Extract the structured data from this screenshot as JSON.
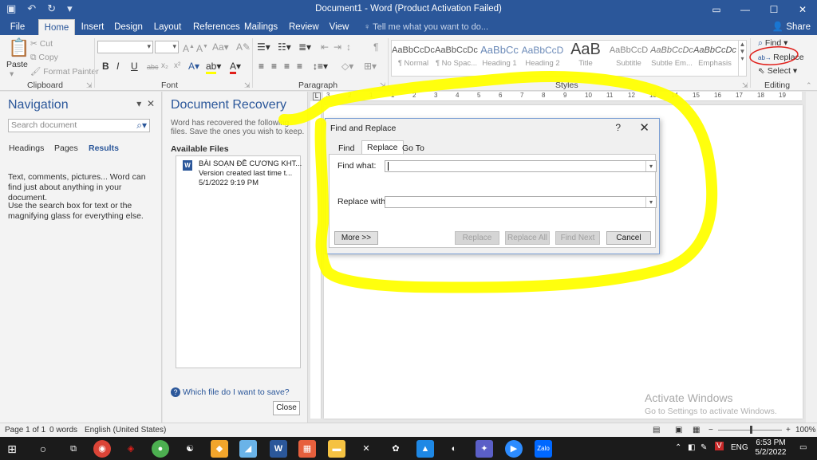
{
  "window": {
    "title": "Document1 - Word (Product Activation Failed)",
    "share": "Share",
    "tell_me": "Tell me what you want to do..."
  },
  "tabs": [
    "File",
    "Home",
    "Insert",
    "Design",
    "Layout",
    "References",
    "Mailings",
    "Review",
    "View"
  ],
  "ribbon": {
    "clipboard": {
      "paste": "Paste",
      "cut": "Cut",
      "copy": "Copy",
      "format_painter": "Format Painter",
      "label": "Clipboard"
    },
    "font": {
      "label": "Font",
      "bold": "B",
      "italic": "I",
      "underline": "U"
    },
    "paragraph": {
      "label": "Paragraph"
    },
    "styles": {
      "label": "Styles",
      "items": [
        {
          "preview": "AaBbCcDc",
          "name": "¶ Normal"
        },
        {
          "preview": "AaBbCcDc",
          "name": "¶ No Spac..."
        },
        {
          "preview": "AaBbCc",
          "name": "Heading 1"
        },
        {
          "preview": "AaBbCcD",
          "name": "Heading 2"
        },
        {
          "preview": "AaB",
          "name": "Title"
        },
        {
          "preview": "AaBbCcD",
          "name": "Subtitle"
        },
        {
          "preview": "AaBbCcDc",
          "name": "Subtle Em..."
        },
        {
          "preview": "AaBbCcDc",
          "name": "Emphasis"
        }
      ]
    },
    "editing": {
      "find": "Find",
      "replace": "Replace",
      "select": "Select",
      "label": "Editing"
    }
  },
  "navigation": {
    "title": "Navigation",
    "search_placeholder": "Search document",
    "tabs": [
      "Headings",
      "Pages",
      "Results"
    ],
    "message1": "Text, comments, pictures... Word can find just about anything in your document.",
    "message2": "Use the search box for text or the magnifying glass for everything else."
  },
  "recovery": {
    "title": "Document Recovery",
    "subtitle": "Word has recovered the following files. Save the ones you wish to keep.",
    "available": "Available Files",
    "file": {
      "name": "BÀI SOẠN ĐỀ CƯƠNG KHT...",
      "version": "Version created last time t...",
      "date": "5/1/2022 9:19 PM"
    },
    "help": "Which file do I want to save?",
    "close": "Close"
  },
  "dialog": {
    "title": "Find and Replace",
    "help": "?",
    "close": "✕",
    "tabs": [
      "Find",
      "Replace",
      "Go To"
    ],
    "find_label": "Find what:",
    "replace_label": "Replace with:",
    "find_value": "",
    "replace_value": "",
    "buttons": {
      "more": "More >>",
      "replace": "Replace",
      "replace_all": "Replace All",
      "find_next": "Find Next",
      "cancel": "Cancel"
    }
  },
  "watermark": {
    "line1": "Activate Windows",
    "line2": "Go to Settings to activate Windows."
  },
  "status": {
    "page": "Page 1 of 1",
    "words": "0 words",
    "language": "English (United States)",
    "zoom": "100%"
  },
  "taskbar": {
    "language": "ENG",
    "time": "6:53 PM",
    "date": "5/2/2022"
  },
  "colors": {
    "accent": "#2b579a",
    "highlight": "#ffff00",
    "annotation_circle": "#e0201b"
  }
}
